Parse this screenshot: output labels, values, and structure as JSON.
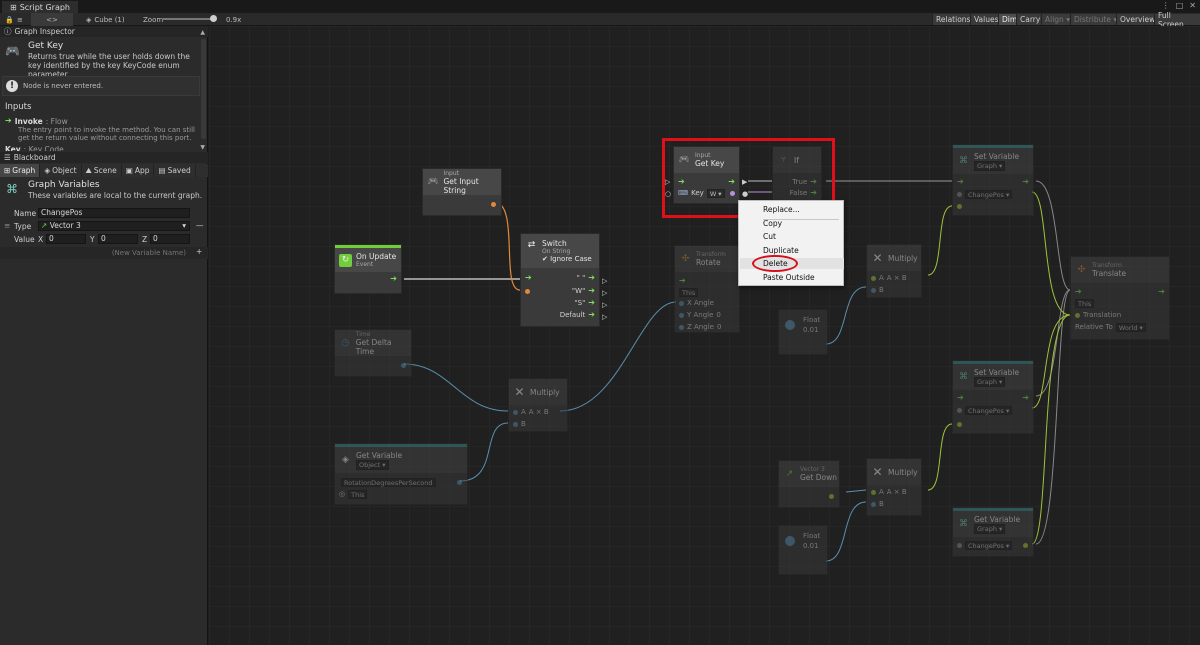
{
  "window": {
    "tab_title": "Script Graph",
    "controls": [
      "⋮",
      "□",
      "✕"
    ]
  },
  "toolbar": {
    "lock_icon": "lock-icon",
    "menu_icon": "menu-icon",
    "code_btn": "<>",
    "target": "Cube (1)",
    "zoom_label": "Zoom",
    "zoom_value": "0.9x",
    "zoom_fraction": 0.9,
    "buttons": [
      "Relations",
      "Values",
      "Dim",
      "Carry",
      "Align ▾",
      "Distribute ▾",
      "Overview",
      "Full Screen"
    ]
  },
  "inspector": {
    "header": "Graph Inspector",
    "node_title": "Get Key",
    "description": "Returns true while the user holds down the key identified by the key KeyCode enum parameter.",
    "warning": "Node is never entered.",
    "inputs_label": "Inputs",
    "invoke_label": "Invoke",
    "invoke_type": ": Flow",
    "invoke_desc": "The entry point to invoke the method. You can still get the return value without connecting this port.",
    "key_label": "Key",
    "key_type": ": Key Code"
  },
  "blackboard": {
    "header": "Blackboard",
    "tabs": [
      "Graph",
      "Object",
      "Scene",
      "App",
      "Saved"
    ],
    "title": "Graph Variables",
    "description": "These variables are local to the current graph.",
    "name_label": "Name",
    "name_value": "ChangePos",
    "type_label": "Type",
    "type_value": "Vector 3",
    "value_label": "Value",
    "x_label": "X",
    "x_value": "0",
    "y_label": "Y",
    "y_value": "0",
    "z_label": "Z",
    "z_value": "0",
    "new_var_placeholder": "(New Variable Name)",
    "add_label": "+",
    "remove_label": "—"
  },
  "nodes": {
    "on_update": {
      "title": "On Update",
      "sub": "Event"
    },
    "get_input_string": {
      "sub": "Input",
      "title": "Get Input String"
    },
    "switch": {
      "title": "Switch",
      "sub": "On String",
      "ignore_case": "✔ Ignore Case",
      "cases": [
        "\" \"",
        "\"W\"",
        "\"S\""
      ],
      "default": "Default"
    },
    "get_key": {
      "sub": "Input",
      "title": "Get Key",
      "key_label": "Key",
      "key_value": "W ▾"
    },
    "if": {
      "title": "If",
      "true_label": "True",
      "false_label": "False"
    },
    "rotate": {
      "sub": "Transform",
      "title": "Rotate",
      "this_value": "This",
      "x": "X Angle",
      "y": "Y Angle",
      "z": "Z Angle",
      "y_value": "0",
      "z_value": "0"
    },
    "float1": {
      "title": "Float",
      "value": "0.01"
    },
    "multiply_top": {
      "title": "Multiply",
      "a": "A",
      "expr": "A × B",
      "b": "B"
    },
    "time": {
      "sub": "Time",
      "title": "Get Delta Time"
    },
    "multiply_mid": {
      "title": "Multiply",
      "a": "A",
      "expr": "A × B",
      "b": "B"
    },
    "get_var_object": {
      "title": "Get Variable",
      "kind": "Object ▾",
      "name": "RotationDegreesPerSecond",
      "this_value": "This"
    },
    "set_var_1": {
      "title": "Set Variable",
      "kind": "Graph ▾",
      "name": "ChangePos ▾"
    },
    "translate": {
      "sub": "Transform",
      "title": "Translate",
      "this_value": "This",
      "translation": "Translation",
      "relative_to": "Relative To",
      "relative_value": "World ▾"
    },
    "set_var_2": {
      "title": "Set Variable",
      "kind": "Graph ▾",
      "name": "ChangePos ▾"
    },
    "vector3": {
      "sub": "Vector 3",
      "title": "Get Down"
    },
    "multiply_bot": {
      "title": "Multiply",
      "a": "A",
      "expr": "A × B",
      "b": "B"
    },
    "float2": {
      "title": "Float",
      "value": "0.01"
    },
    "get_var_graph": {
      "title": "Get Variable",
      "kind": "Graph ▾",
      "name": "ChangePos ▾"
    }
  },
  "context_menu": {
    "items": [
      "Replace...",
      "Copy",
      "Cut",
      "Duplicate",
      "Delete",
      "Paste Outside"
    ],
    "hover_index": 4
  },
  "colors": {
    "flow": "#7ee05a",
    "orange_port": "#e08a3a",
    "purple_port": "#b98ee0",
    "teal_strip": "#3c8d8a",
    "green_strip": "#6fce3a",
    "highlight_red": "#e0101a"
  }
}
